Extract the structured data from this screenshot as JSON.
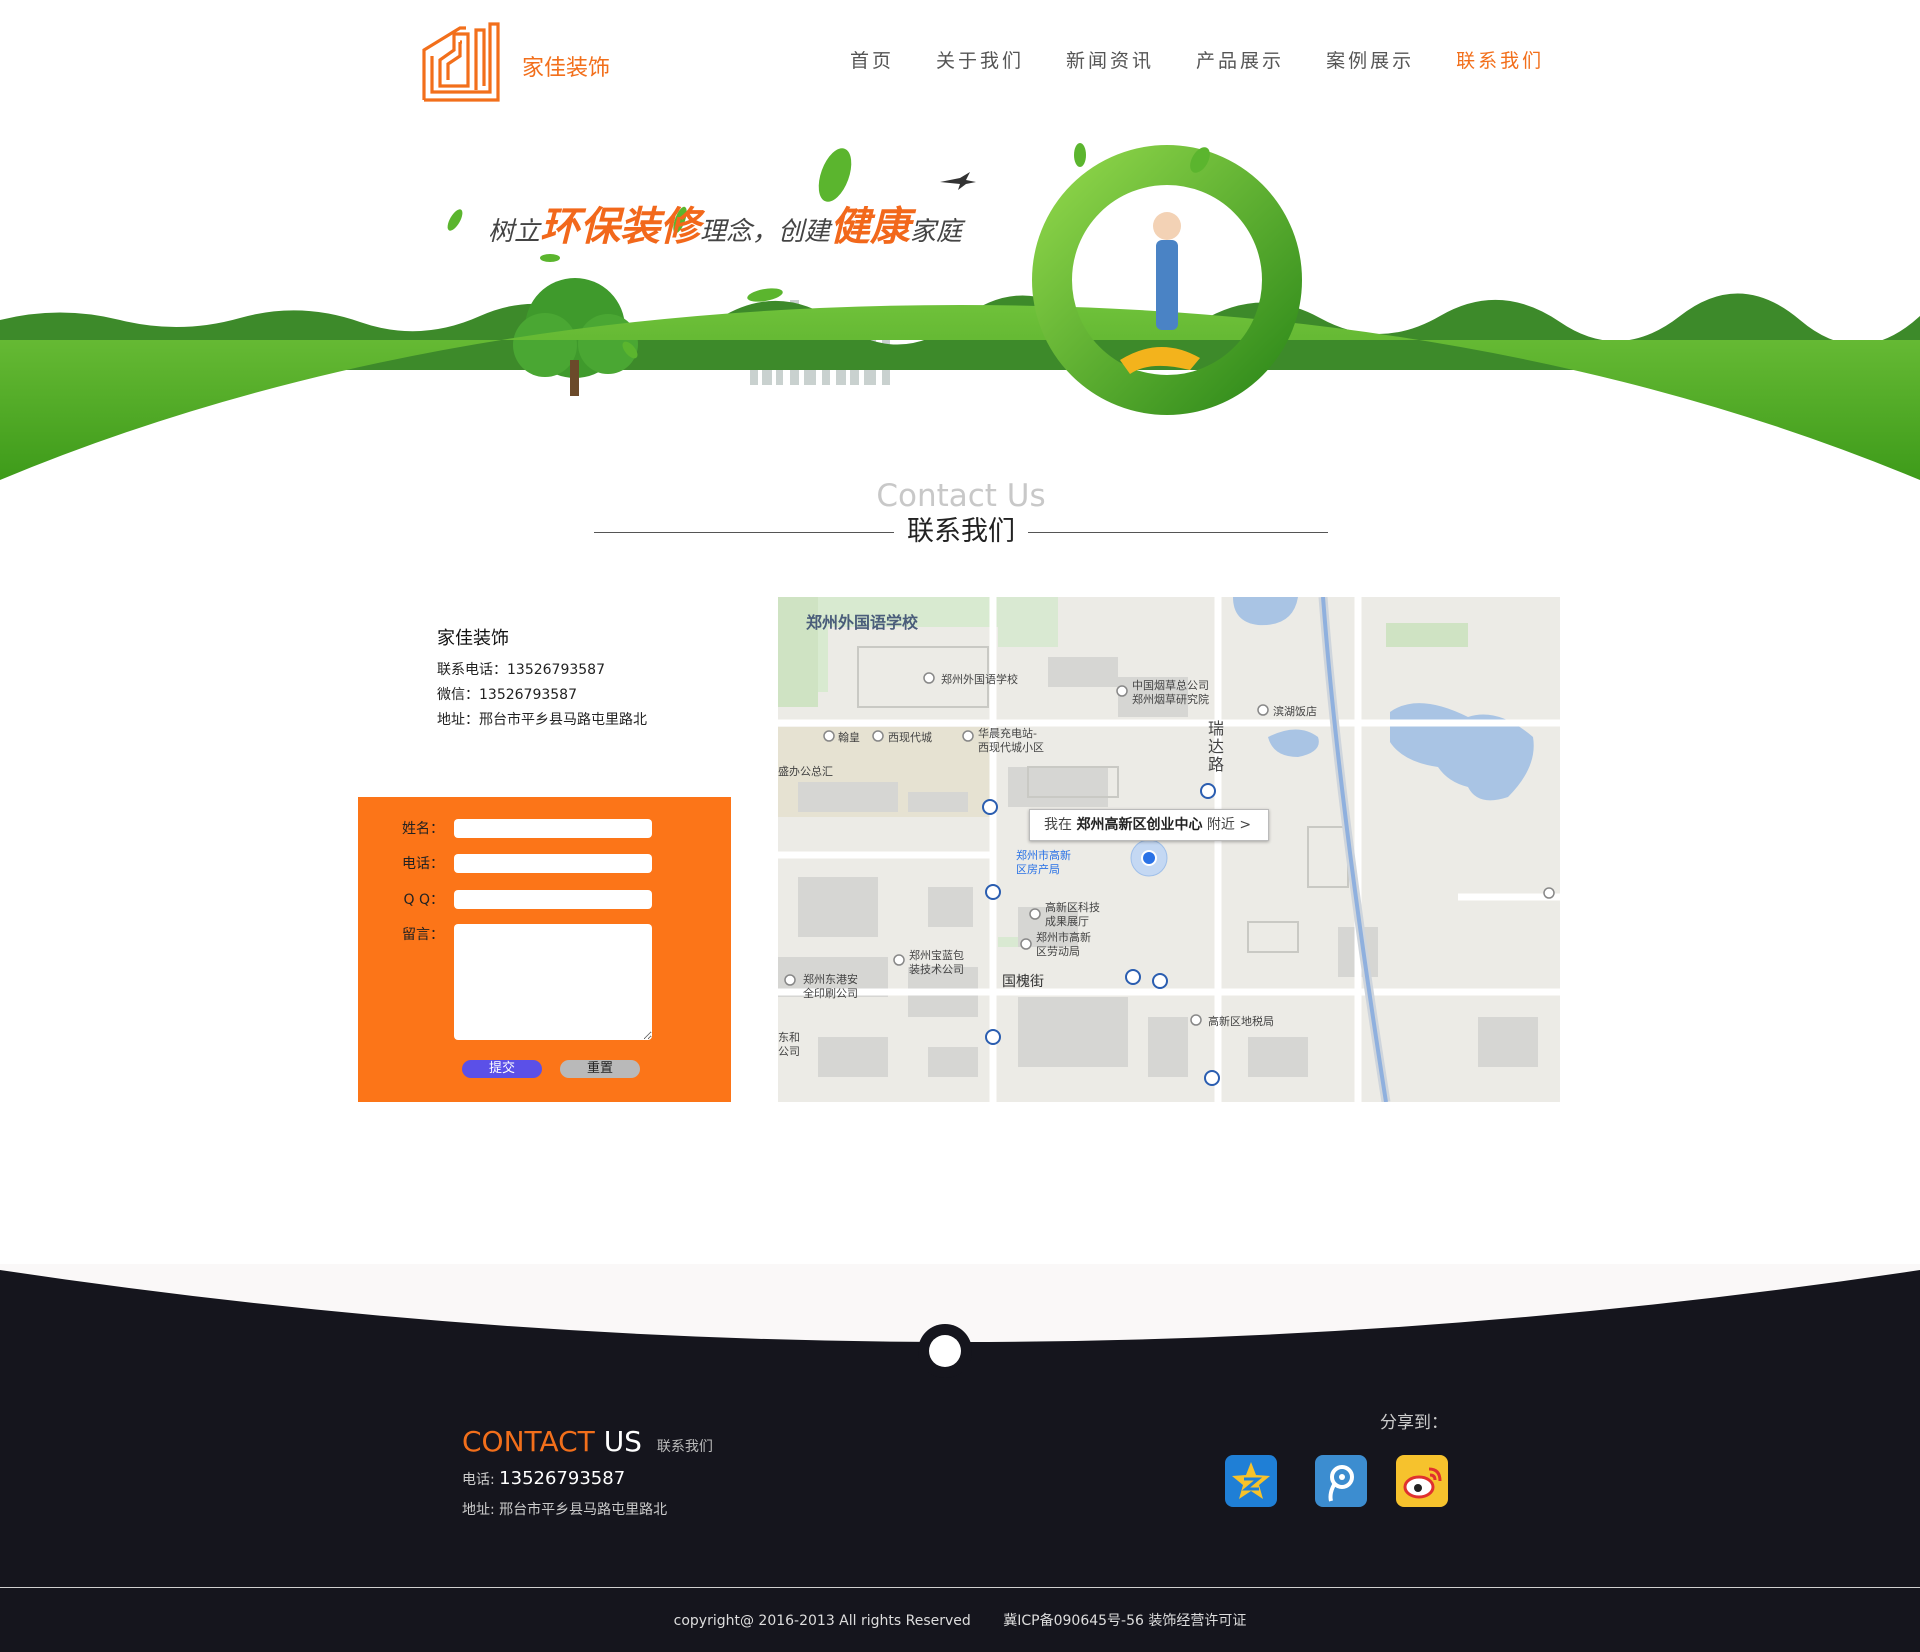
{
  "brand": {
    "name": "家佳装饰",
    "accent": "#f26f1b"
  },
  "nav": {
    "items": [
      "首页",
      "关于我们",
      "新闻资讯",
      "产品展示",
      "案例展示",
      "联系我们"
    ],
    "active_index": 5
  },
  "banner": {
    "slogan": {
      "p1": "树立",
      "h1": "环保装修",
      "p2": "理念，",
      "p3": "创建",
      "h2": "健康",
      "p4": "家庭"
    }
  },
  "section": {
    "title_en": "Contact Us",
    "title_cn": "联系我们"
  },
  "company": {
    "name": "家佳装饰",
    "phone_line": "联系电话：13526793587",
    "wechat_line": "微信：13526793587",
    "address_line": "地址：邢台市平乡县马路屯里路北"
  },
  "form": {
    "name_label": "姓名：",
    "phone_label": "电话：",
    "qq_label": "Q Q：",
    "message_label": "留言：",
    "submit_label": "提交",
    "reset_label": "重置",
    "bg_color": "#fc7518"
  },
  "map": {
    "bubble_prefix": "我在",
    "bubble_place": "郑州高新区创业中心",
    "bubble_suffix": "附近 >",
    "labels": [
      "郑州外国语学校",
      "郑州外国语学校",
      "中国烟草总公司",
      "郑州烟草研究院",
      "滨湖饭店",
      "瑞",
      "达",
      "路",
      "翰皇",
      "西现代城",
      "华晨充电站-",
      "西现代城小区",
      "盛办公总汇",
      "郑州市高新",
      "区房产局",
      "高新区科技",
      "成果展厅",
      "郑州市高新",
      "区劳动局",
      "郑州宝蓝包",
      "装技术公司",
      "郑州东港安",
      "全印刷公司",
      "国槐街",
      "高新区地税局",
      "东和",
      "公司"
    ]
  },
  "footer": {
    "title_orange": "CONTACT",
    "title_white": "US",
    "title_cn": "联系我们",
    "phone_label": "电话:",
    "phone": "13526793587",
    "address": "地址: 邢台市平乡县马路屯里路北",
    "share_label": "分享到：",
    "share_icons": [
      "qzone-icon",
      "tencent-weibo-icon",
      "sina-weibo-icon"
    ],
    "copyright": "copyright@ 2016-2013    All rights Reserved",
    "icp": "冀ICP备090645号-56 装饰经营许可证"
  }
}
